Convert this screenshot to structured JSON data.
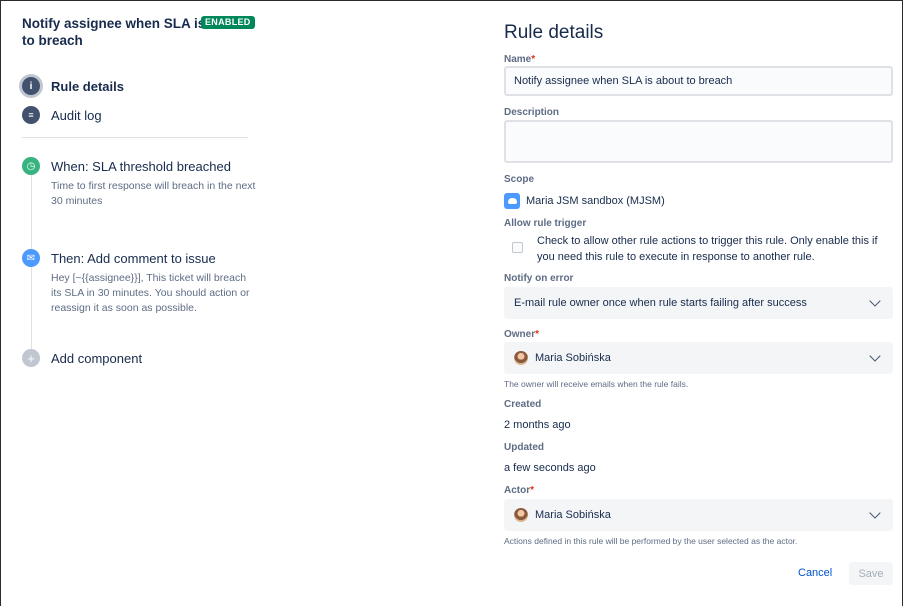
{
  "rule": {
    "title": "Notify assignee when SLA is about to breach",
    "status_badge": "ENABLED"
  },
  "nav": {
    "items": [
      {
        "label": "Rule details",
        "icon": "info-icon",
        "active": true
      },
      {
        "label": "Audit log",
        "icon": "list-icon",
        "active": false
      }
    ]
  },
  "components": {
    "trigger": {
      "label": "When: SLA threshold breached",
      "description": "Time to first response will breach in the next 30 minutes",
      "icon": "clock-icon",
      "color": "#36b37e"
    },
    "action": {
      "label": "Then: Add comment to issue",
      "description": "Hey [~{{assignee}}], This ticket will breach its SLA in 30 minutes. You should action or reassign it as soon as possible.",
      "icon": "comment-icon",
      "color": "#4c9aff"
    },
    "add": {
      "label": "Add component",
      "icon": "plus-icon",
      "color": "#c1c7d0"
    }
  },
  "details": {
    "heading": "Rule details",
    "name": {
      "label": "Name",
      "value": "Notify assignee when SLA is about to breach"
    },
    "description": {
      "label": "Description",
      "value": ""
    },
    "scope": {
      "label": "Scope",
      "value": "Maria JSM sandbox (MJSM)"
    },
    "allow_trigger": {
      "label": "Allow rule trigger",
      "text": "Check to allow other rule actions to trigger this rule. Only enable this if you need this rule to execute in response to another rule.",
      "checked": false
    },
    "notify": {
      "label": "Notify on error",
      "value": "E-mail rule owner once when rule starts failing after success"
    },
    "owner": {
      "label": "Owner",
      "value": "Maria Sobińska",
      "help": "The owner will receive emails when the rule fails."
    },
    "created": {
      "label": "Created",
      "value": "2 months ago"
    },
    "updated": {
      "label": "Updated",
      "value": "a few seconds ago"
    },
    "actor": {
      "label": "Actor",
      "value": "Maria Sobińska",
      "help": "Actions defined in this rule will be performed by the user selected as the actor."
    },
    "required_mark": "*"
  },
  "buttons": {
    "cancel": "Cancel",
    "save": "Save"
  }
}
